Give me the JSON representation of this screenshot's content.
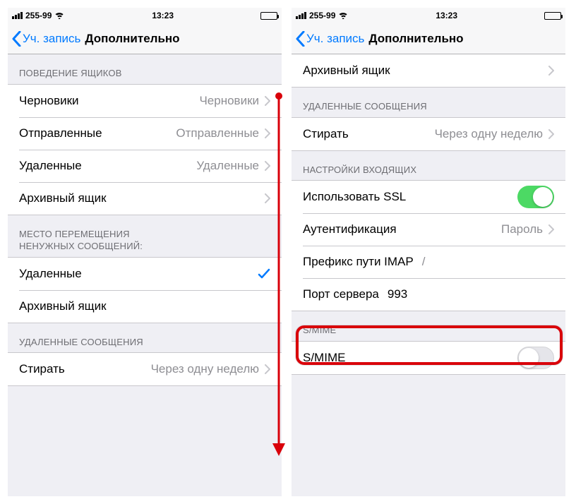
{
  "status": {
    "carrier": "255-99",
    "time": "13:23"
  },
  "nav": {
    "back": "Уч. запись",
    "title": "Дополнительно"
  },
  "left": {
    "section_mailbox_behavior": "ПОВЕДЕНИЕ ЯЩИКОВ",
    "drafts_label": "Черновики",
    "drafts_value": "Черновики",
    "sent_label": "Отправленные",
    "sent_value": "Отправленные",
    "deleted_label": "Удаленные",
    "deleted_value": "Удаленные",
    "archive_label": "Архивный ящик",
    "section_move_discarded": "МЕСТО ПЕРЕМЕЩЕНИЯ\nНЕНУЖНЫХ СООБЩЕНИЙ:",
    "opt_deleted": "Удаленные",
    "opt_archive": "Архивный ящик",
    "section_deleted_messages": "УДАЛЕННЫЕ СООБЩЕНИЯ",
    "remove_label": "Стирать",
    "remove_value": "Через одну неделю"
  },
  "right": {
    "archive_label": "Архивный ящик",
    "section_deleted_messages": "УДАЛЕННЫЕ СООБЩЕНИЯ",
    "remove_label": "Стирать",
    "remove_value": "Через одну неделю",
    "section_incoming": "НАСТРОЙКИ ВХОДЯЩИХ",
    "use_ssl_label": "Использовать SSL",
    "auth_label": "Аутентификация",
    "auth_value": "Пароль",
    "imap_prefix_label": "Префикс пути IMAP",
    "imap_prefix_value": "/",
    "server_port_label": "Порт сервера",
    "server_port_value": "993",
    "section_smime": "S/MIME",
    "smime_label": "S/MIME"
  }
}
